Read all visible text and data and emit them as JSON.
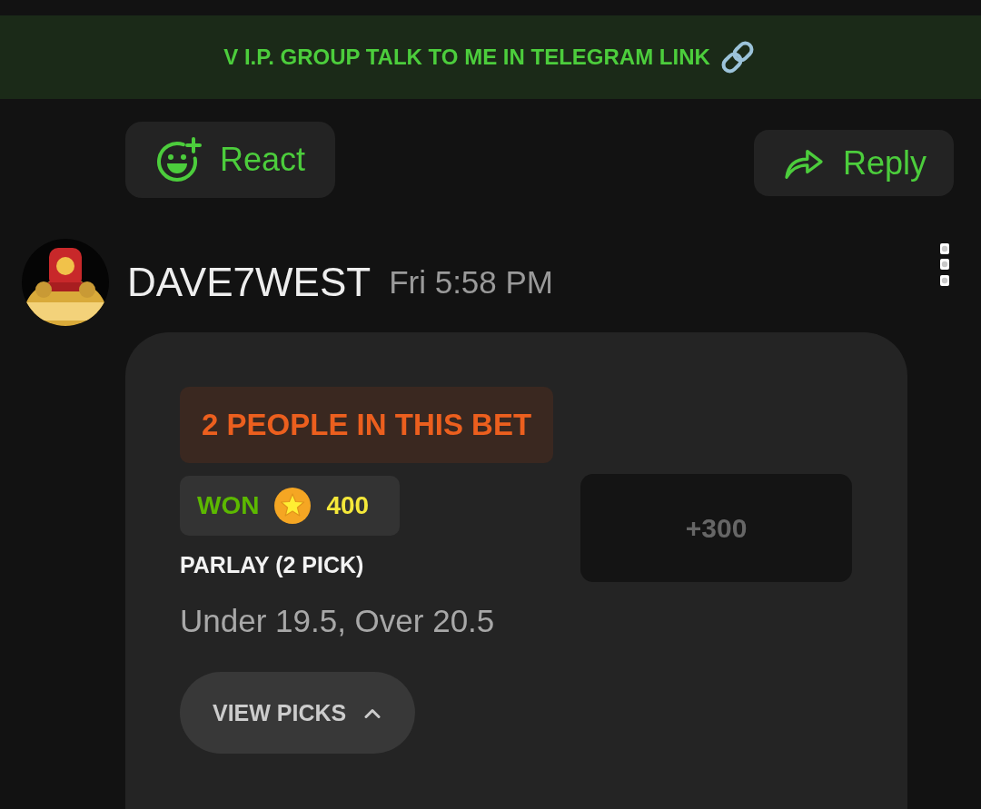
{
  "banner": {
    "text": "V I.P. GROUP TALK TO ME IN TELEGRAM LINK"
  },
  "actions": [
    {
      "kind": "react",
      "label": "React"
    },
    {
      "kind": "reply",
      "label": "Reply"
    }
  ],
  "message": {
    "author": "DAVE7WEST",
    "time": "Fri 5:58 PM",
    "bet": {
      "participants": "2 PEOPLE IN THIS BET",
      "result": {
        "status": "WON",
        "amount": "400"
      },
      "title": "PARLAY (2 PICK)",
      "picks": "Under 19.5, Over 20.5",
      "odds": "+300",
      "toggle": "VIEW PICKS"
    }
  }
}
